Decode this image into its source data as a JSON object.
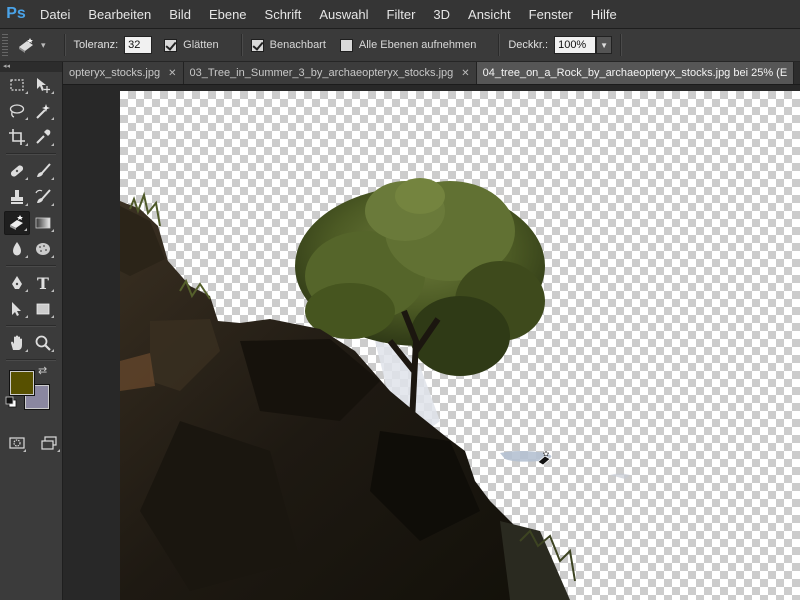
{
  "app": {
    "logo": "Ps",
    "menu": [
      "Datei",
      "Bearbeiten",
      "Bild",
      "Ebene",
      "Schrift",
      "Auswahl",
      "Filter",
      "3D",
      "Ansicht",
      "Fenster",
      "Hilfe"
    ]
  },
  "options": {
    "tool_icon": "magic-eraser-icon",
    "tolerance_label": "Toleranz:",
    "tolerance_value": "32",
    "antialias_label": "Glätten",
    "antialias_checked": true,
    "contiguous_label": "Benachbart",
    "contiguous_checked": true,
    "all_layers_label": "Alle Ebenen aufnehmen",
    "all_layers_checked": false,
    "opacity_label": "Deckkr.:",
    "opacity_value": "100%"
  },
  "tabs": [
    {
      "label": "opteryx_stocks.jpg",
      "active": false
    },
    {
      "label": "03_Tree_in_Summer_3_by_archaeopteryx_stocks.jpg",
      "active": false
    },
    {
      "label": "04_tree_on_a_Rock_by_archaeopteryx_stocks.jpg bei 25% (E",
      "active": true
    }
  ],
  "toolbox": {
    "foreground_color": "#575000",
    "background_color": "#8a87a0",
    "tools": [
      "rectangular-marquee-icon",
      "move-icon",
      "lasso-icon",
      "magic-wand-icon",
      "crop-icon",
      "eyedropper-icon",
      "healing-brush-icon",
      "brush-icon",
      "clone-stamp-icon",
      "history-brush-icon",
      "magic-eraser-icon",
      "gradient-icon",
      "blur-icon",
      "sponge-icon",
      "pen-icon",
      "type-icon",
      "path-selection-icon",
      "rectangle-shape-icon",
      "hand-icon",
      "zoom-icon"
    ],
    "active_tool": "magic-eraser-icon",
    "type_tool_glyph": "T"
  },
  "colors": {
    "accent": "#4aa3e8",
    "checker_light": "#ffffff",
    "checker_dark": "#cccccc",
    "rock": "#1f1a14",
    "foliage": "#4a5a25"
  }
}
